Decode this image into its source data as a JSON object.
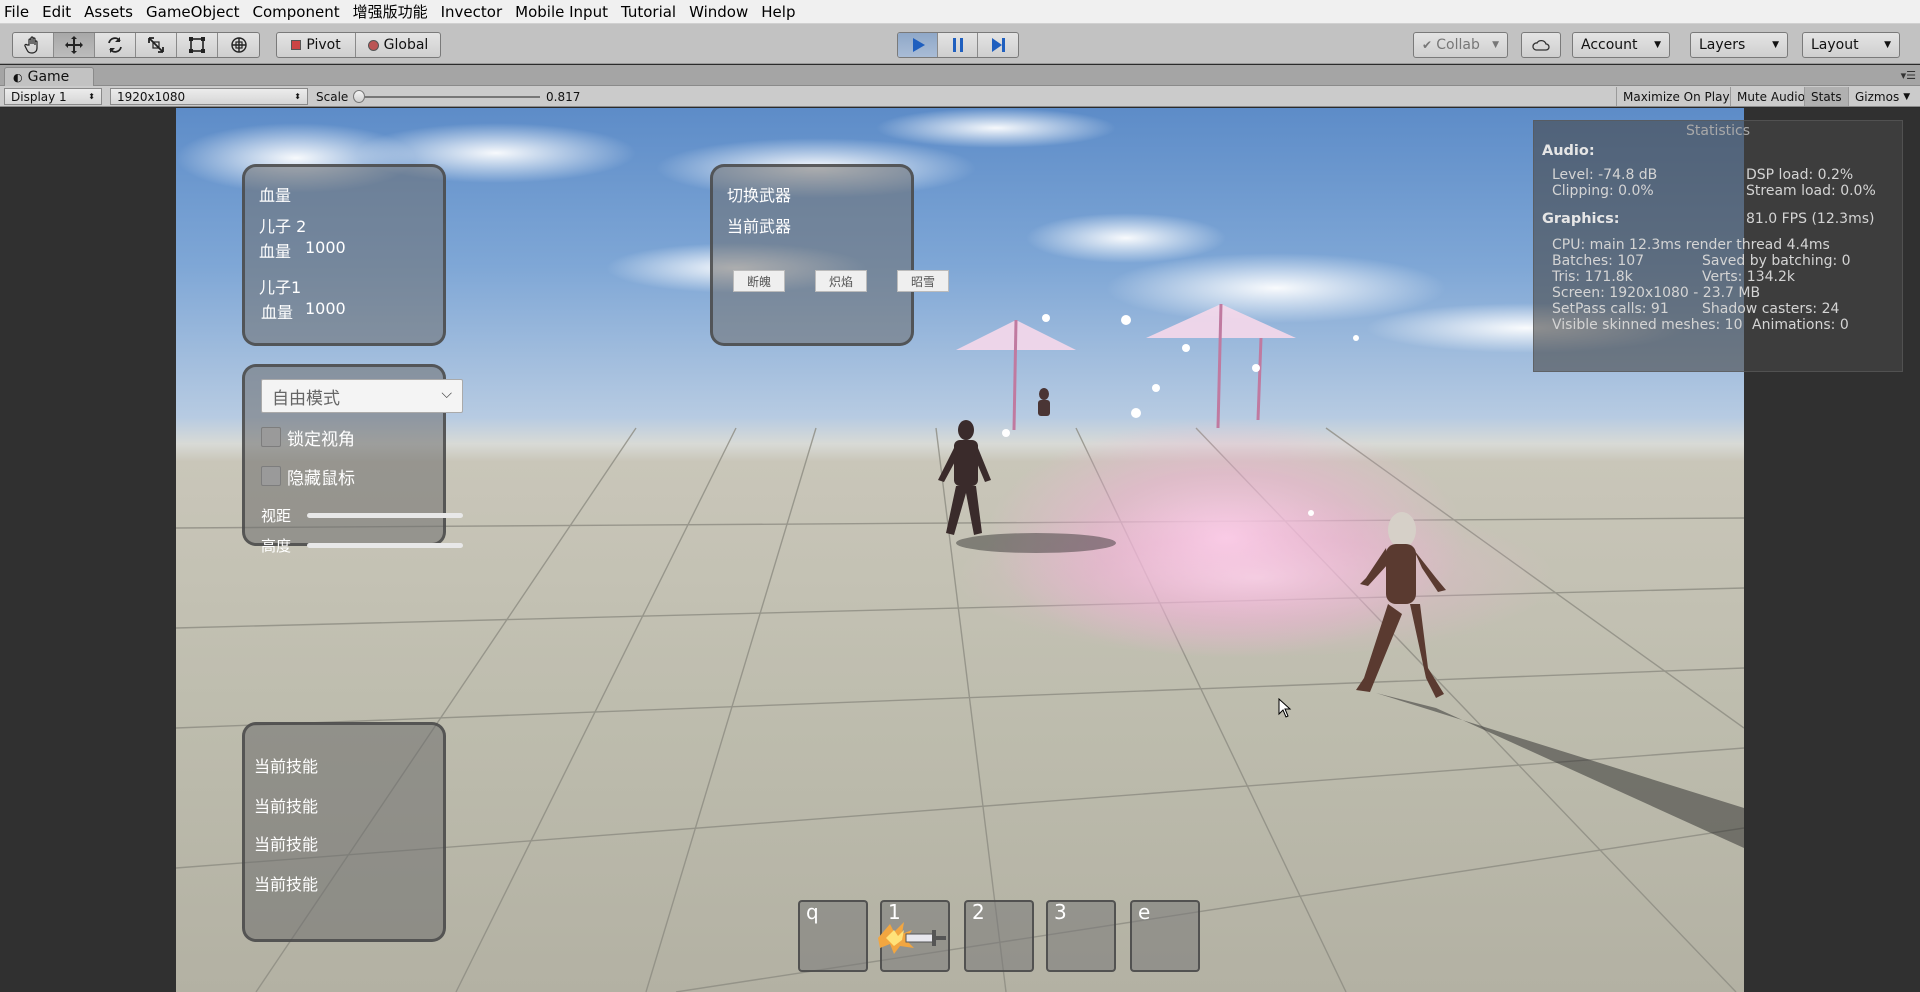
{
  "menu": [
    "File",
    "Edit",
    "Assets",
    "GameObject",
    "Component",
    "增强版功能",
    "Invector",
    "Mobile Input",
    "Tutorial",
    "Window",
    "Help"
  ],
  "toolbar": {
    "tools": [
      "hand-icon",
      "move-icon",
      "rotate-icon",
      "scale-icon",
      "rect-icon",
      "transform-icon"
    ],
    "pivot_label": "Pivot",
    "global_label": "Global",
    "play": [
      "play-icon",
      "pause-icon",
      "step-icon"
    ],
    "collab_label": "Collab",
    "account_label": "Account",
    "layers_label": "Layers",
    "layout_label": "Layout"
  },
  "tab": {
    "title": "Game"
  },
  "gamebar": {
    "display": "Display 1",
    "resolution": "1920x1080",
    "scale_label": "Scale",
    "scale_value": "0.817",
    "scale_fraction": 0.0,
    "maximize_label": "Maximize On Play",
    "mute_label": "Mute Audio",
    "stats_label": "Stats",
    "gizmos_label": "Gizmos"
  },
  "hud": {
    "health_panel": {
      "title": "血量",
      "son2_label": "儿子 2",
      "son2_hp_label": "血量",
      "son2_hp_value": "1000",
      "son1_label": "儿子1",
      "son1_hp_label": "血量",
      "son1_hp_value": "1000"
    },
    "weapon_panel": {
      "title": "切换武器",
      "current_label": "当前武器",
      "weapons": [
        "断魄",
        "炽焰",
        "昭雪"
      ]
    },
    "mode_panel": {
      "mode_value": "自由模式",
      "lock_view_label": "锁定视角",
      "lock_view_checked": false,
      "hide_cursor_label": "隐藏鼠标",
      "hide_cursor_checked": false,
      "distance_label": "视距",
      "height_label": "高度"
    },
    "skill_panel": {
      "lines": [
        "当前技能",
        "当前技能",
        "当前技能",
        "当前技能"
      ]
    },
    "skill_bar": [
      {
        "key": "q"
      },
      {
        "key": "1"
      },
      {
        "key": "2"
      },
      {
        "key": "3"
      },
      {
        "key": "e"
      }
    ]
  },
  "stats": {
    "title": "Statistics",
    "audio_header": "Audio:",
    "level": "Level: -74.8 dB",
    "dsp": "DSP load: 0.2%",
    "clipping": "Clipping: 0.0%",
    "stream": "Stream load: 0.0%",
    "graphics_header": "Graphics:",
    "fps": "81.0 FPS (12.3ms)",
    "cpu": "CPU: main 12.3ms  render thread 4.4ms",
    "batches": "Batches: 107",
    "saved": "Saved by batching: 0",
    "tris": "Tris: 171.8k",
    "verts": "Verts: 134.2k",
    "screen": "Screen: 1920x1080 - 23.7 MB",
    "setpass": "SetPass calls: 91",
    "shadow": "Shadow casters: 24",
    "skinned": "Visible skinned meshes: 10",
    "animations": "Animations: 0"
  }
}
